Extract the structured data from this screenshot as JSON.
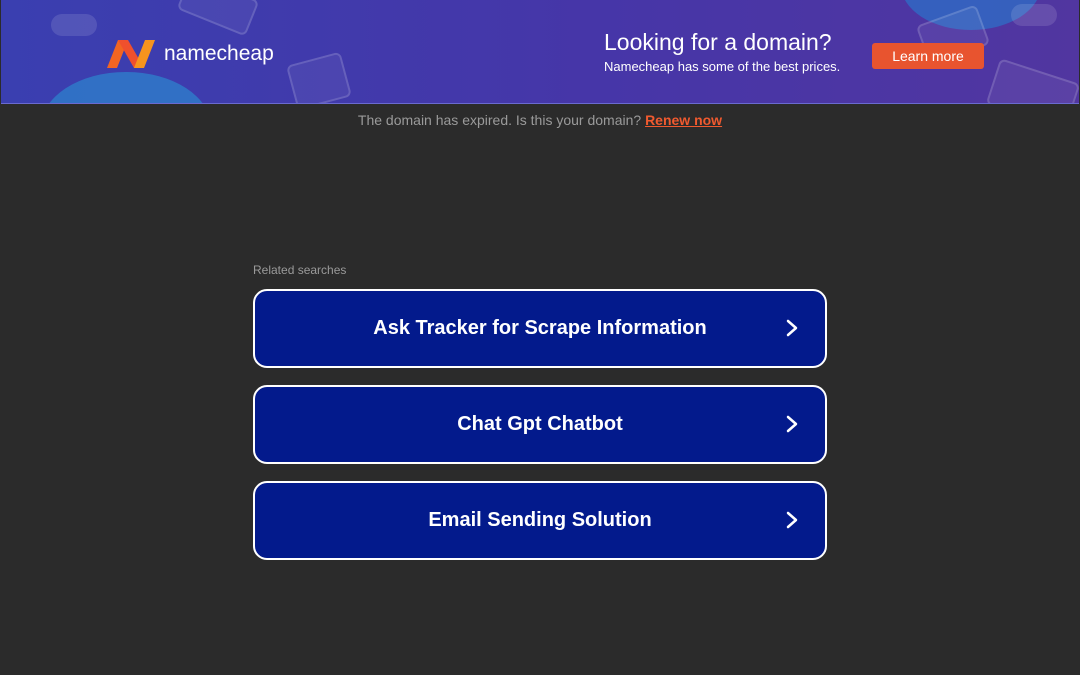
{
  "banner": {
    "brand": "namecheap",
    "headline": "Looking for a domain?",
    "subline": "Namecheap has some of the best prices.",
    "cta": "Learn more",
    "colors": {
      "background": "#4236a8",
      "accent": "#e8542f",
      "logo_orange": "#f26522"
    }
  },
  "notice": {
    "text": "The domain has expired. Is this your domain?",
    "link": "Renew now"
  },
  "related": {
    "label": "Related searches",
    "items": [
      {
        "label": "Ask Tracker for Scrape Information",
        "icon": "chevron-right-icon"
      },
      {
        "label": "Chat Gpt Chatbot",
        "icon": "chevron-right-icon"
      },
      {
        "label": "Email Sending Solution",
        "icon": "chevron-right-icon"
      }
    ]
  }
}
